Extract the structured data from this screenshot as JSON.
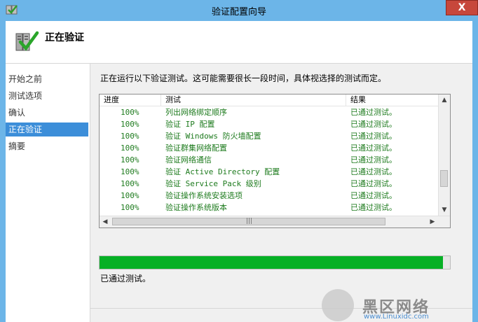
{
  "window": {
    "title": "验证配置向导",
    "close_symbol": "X"
  },
  "header": {
    "title": "正在验证",
    "icon": "validate-servers-icon"
  },
  "sidebar": {
    "items": [
      {
        "label": "开始之前",
        "active": false
      },
      {
        "label": "测试选项",
        "active": false
      },
      {
        "label": "确认",
        "active": false
      },
      {
        "label": "正在验证",
        "active": true
      },
      {
        "label": "摘要",
        "active": false
      }
    ]
  },
  "content": {
    "description": "正在运行以下验证测试。这可能需要很长一段时间，具体视选择的测试而定。",
    "table": {
      "columns": [
        "进度",
        "测试",
        "结果"
      ],
      "rows": [
        {
          "progress": "100%",
          "test": "列出网络绑定顺序",
          "result": "已通过测试。"
        },
        {
          "progress": "100%",
          "test": "验证 IP 配置",
          "result": "已通过测试。"
        },
        {
          "progress": "100%",
          "test": "验证 Windows 防火墙配置",
          "result": "已通过测试。"
        },
        {
          "progress": "100%",
          "test": "验证群集网络配置",
          "result": "已通过测试。"
        },
        {
          "progress": "100%",
          "test": "验证网络通信",
          "result": "已通过测试。"
        },
        {
          "progress": "100%",
          "test": "验证 Active Directory 配置",
          "result": "已通过测试。"
        },
        {
          "progress": "100%",
          "test": "验证 Service Pack 级别",
          "result": "已通过测试。"
        },
        {
          "progress": "100%",
          "test": "验证操作系统安装选项",
          "result": "已通过测试。"
        },
        {
          "progress": "100%",
          "test": "验证操作系统版本",
          "result": "已通过测试。"
        }
      ]
    },
    "progress_value": 0.98,
    "status_text": "已通过测试。",
    "colors": {
      "progress": "#06b025",
      "selection": "#3c8ed9",
      "title_bar": "#6cb5e8",
      "close": "#c7473b"
    }
  },
  "watermark": {
    "text": "黑区网络",
    "url": "www.Linuxidc.com"
  }
}
